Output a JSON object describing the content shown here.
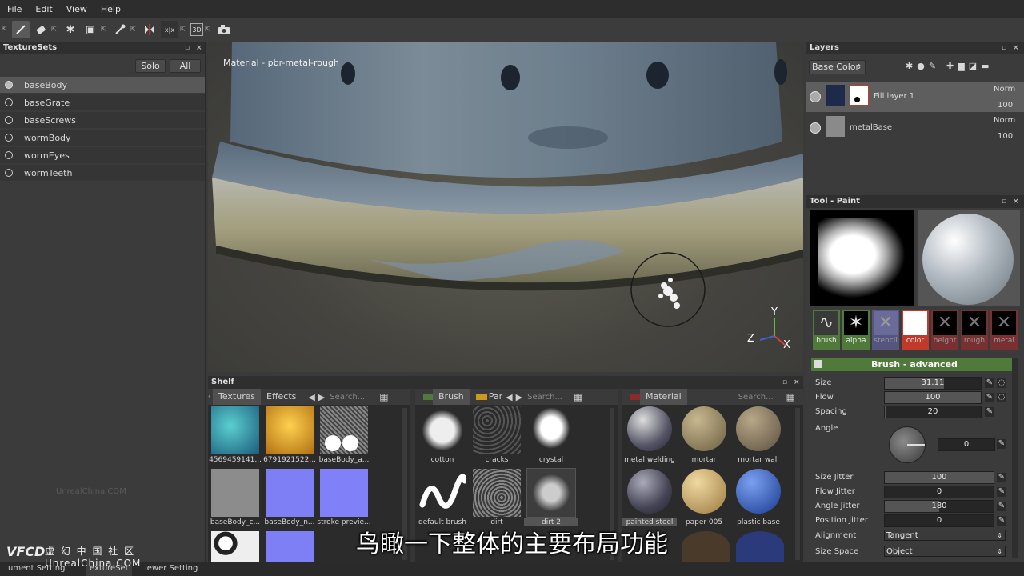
{
  "menu": [
    "File",
    "Edit",
    "View",
    "Help"
  ],
  "texturesets": {
    "title": "TextureSets",
    "solo_label": "Solo",
    "all_label": "All",
    "items": [
      "baseBody",
      "baseGrate",
      "baseScrews",
      "wormBody",
      "wormEyes",
      "wormTeeth"
    ]
  },
  "viewport": {
    "material_label": "Material - pbr-metal-rough",
    "axes": {
      "y": "Y",
      "z": "Z",
      "x": "X"
    }
  },
  "shelf": {
    "title": "Shelf",
    "col1": {
      "tabs": [
        "Textures",
        "Effects"
      ],
      "search_placeholder": "Search...",
      "items": [
        "4569459141...",
        "6791921522...",
        "baseBody_a...",
        "baseBody_c...",
        "baseBody_n...",
        "stroke previe..."
      ]
    },
    "col2": {
      "tabs": [
        "Brush",
        "Par"
      ],
      "search_placeholder": "Search...",
      "items": [
        "cotton",
        "cracks",
        "crystal",
        "default brush",
        "dirt",
        "dirt 2"
      ]
    },
    "col3": {
      "tabs": [
        "Material"
      ],
      "search_placeholder": "Search...",
      "items": [
        "metal welding",
        "mortar",
        "mortar wall",
        "painted steel",
        "paper 005",
        "plastic base"
      ]
    }
  },
  "layers": {
    "title": "Layers",
    "channel": "Base Color",
    "rows": [
      {
        "name": "Fill layer 1",
        "blend": "Norm",
        "opacity": "100"
      },
      {
        "name": "metalBase",
        "blend": "Norm",
        "opacity": "100"
      }
    ]
  },
  "tool": {
    "title": "Tool - Paint",
    "slots": [
      {
        "label": "brush"
      },
      {
        "label": "alpha"
      },
      {
        "label": "stencil"
      },
      {
        "label": "color"
      },
      {
        "label": "height"
      },
      {
        "label": "rough"
      },
      {
        "label": "metal"
      }
    ],
    "section": "Brush - advanced",
    "props": {
      "size": {
        "label": "Size",
        "value": "31.11",
        "level": 0.62
      },
      "flow": {
        "label": "Flow",
        "value": "100",
        "level": 1.0
      },
      "spacing": {
        "label": "Spacing",
        "value": "20",
        "level": 0.02
      },
      "angle": {
        "label": "Angle",
        "value": "0"
      },
      "size_jitter": {
        "label": "Size Jitter",
        "value": "100",
        "level": 1.0
      },
      "flow_jitter": {
        "label": "Flow Jitter",
        "value": "0",
        "level": 0
      },
      "angle_jitter": {
        "label": "Angle Jitter",
        "value": "180",
        "level": 0.5
      },
      "position_jitter": {
        "label": "Position Jitter",
        "value": "0",
        "level": 0
      },
      "alignment": {
        "label": "Alignment",
        "value": "Tangent"
      },
      "size_space": {
        "label": "Size Space",
        "value": "Object"
      }
    }
  },
  "status": {
    "tabs": [
      "ument Setting",
      "extureSet",
      "iewer Setting"
    ],
    "watermark_top": "UnrealChina.COM",
    "watermark_logo": "虚 幻 中 国 社 区",
    "watermark_bottom": "UnrealChina.COM"
  },
  "subtitle": "鸟瞰一下整体的主要布局功能",
  "colors": {
    "accent_green": "#4f7a3a",
    "panel": "#3b3b3b",
    "dark": "#2b2b2b"
  }
}
